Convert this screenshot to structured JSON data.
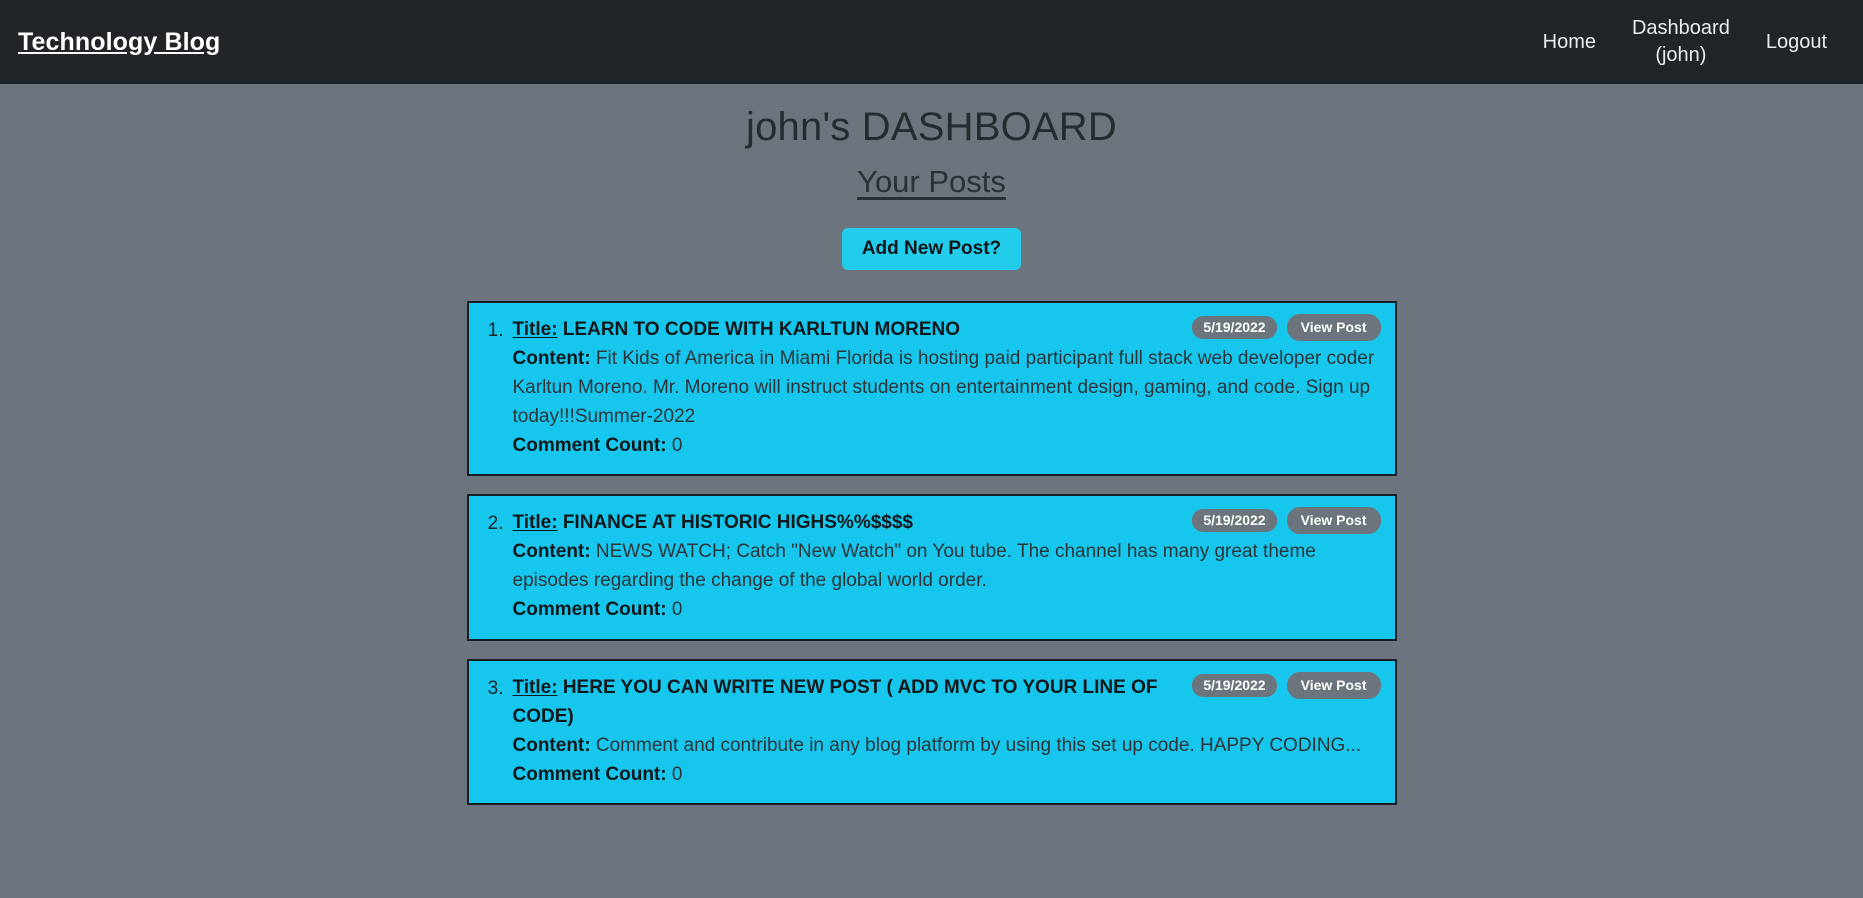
{
  "navbar": {
    "brand": "Technology Blog",
    "links": [
      {
        "label": "Home",
        "name": "nav-link-home"
      },
      {
        "label": "Dashboard\n(john)",
        "name": "nav-link-dashboard"
      },
      {
        "label": "Logout",
        "name": "nav-link-logout"
      }
    ],
    "background_color": "#212529",
    "brand_color": "#ffffff"
  },
  "page": {
    "title": "john's DASHBOARD",
    "subtitle": "Your Posts",
    "background_color": "#6c757d",
    "accent_color": "#16c6ec"
  },
  "actions": {
    "add_new_post_label": "Add New Post?"
  },
  "labels": {
    "title": "Title:",
    "content": "Content:",
    "comment_count": "Comment Count:",
    "view_post": "View Post"
  },
  "posts": [
    {
      "index": "1.",
      "title": "LEARN TO CODE WITH KARLTUN MORENO",
      "content": "Fit Kids of America in Miami Florida is hosting paid participant full stack web developer coder Karltun Moreno. Mr. Moreno will instruct students on entertainment design, gaming, and code. Sign up today!!!Summer-2022",
      "comment_count": "0",
      "date": "5/19/2022",
      "view_post": "View Post"
    },
    {
      "index": "2.",
      "title": "FINANCE AT HISTORIC HIGHS%%$$$$",
      "content": "NEWS WATCH; Catch \"New Watch\" on You tube. The channel has many great theme episodes regarding the change of the global world order.",
      "comment_count": "0",
      "date": "5/19/2022",
      "view_post": "View Post"
    },
    {
      "index": "3.",
      "title": "HERE YOU CAN WRITE NEW POST ( ADD MVC TO YOUR LINE OF CODE)",
      "content": "Comment and contribute in any blog platform by using this set up code. HAPPY CODING...",
      "comment_count": "0",
      "date": "5/19/2022",
      "view_post": "View Post"
    }
  ]
}
